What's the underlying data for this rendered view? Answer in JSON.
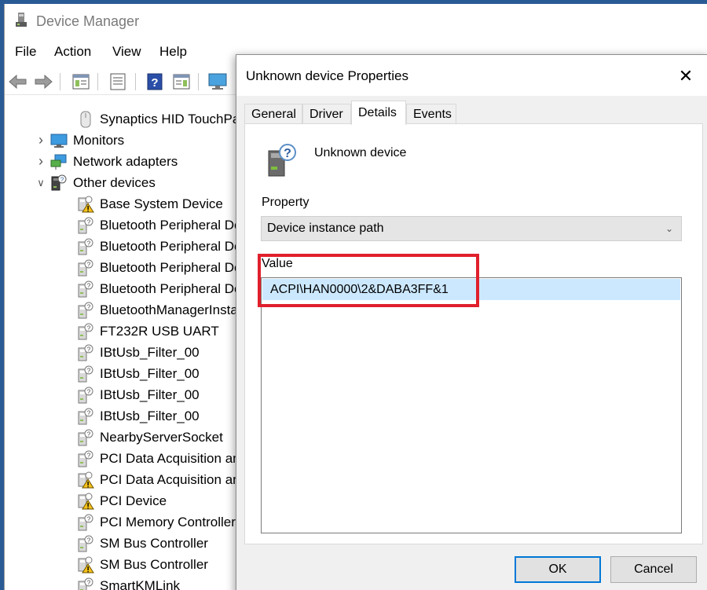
{
  "device_manager": {
    "title": "Device Manager",
    "menu": [
      "File",
      "Action",
      "View",
      "Help"
    ],
    "toolbar_icons": [
      "back-arrow-icon",
      "forward-arrow-icon",
      "properties-icon",
      "list-icon",
      "help-icon",
      "scan-icon",
      "monitor-icon"
    ],
    "tree": [
      {
        "label": "Synaptics HID TouchPad",
        "level": 2,
        "icon": "touchpad-icon"
      },
      {
        "label": "Monitors",
        "level": 1,
        "expander": "collapsed",
        "icon": "monitor-icon"
      },
      {
        "label": "Network adapters",
        "level": 1,
        "expander": "collapsed",
        "icon": "network-adapter-icon"
      },
      {
        "label": "Other devices",
        "level": 1,
        "expander": "expanded",
        "icon": "unknown-device-icon"
      },
      {
        "label": "Base System Device",
        "level": 2,
        "icon": "device-warning-icon"
      },
      {
        "label": "Bluetooth Peripheral Device",
        "level": 2,
        "icon": "unknown-device-icon"
      },
      {
        "label": "Bluetooth Peripheral Device",
        "level": 2,
        "icon": "unknown-device-icon"
      },
      {
        "label": "Bluetooth Peripheral Device",
        "level": 2,
        "icon": "unknown-device-icon"
      },
      {
        "label": "Bluetooth Peripheral Device",
        "level": 2,
        "icon": "unknown-device-icon"
      },
      {
        "label": "BluetoothManagerInstaller",
        "level": 2,
        "icon": "unknown-device-icon"
      },
      {
        "label": "FT232R USB UART",
        "level": 2,
        "icon": "unknown-device-icon"
      },
      {
        "label": "IBtUsb_Filter_00",
        "level": 2,
        "icon": "unknown-device-icon"
      },
      {
        "label": "IBtUsb_Filter_00",
        "level": 2,
        "icon": "unknown-device-icon"
      },
      {
        "label": "IBtUsb_Filter_00",
        "level": 2,
        "icon": "unknown-device-icon"
      },
      {
        "label": "IBtUsb_Filter_00",
        "level": 2,
        "icon": "unknown-device-icon"
      },
      {
        "label": "NearbyServerSocket",
        "level": 2,
        "icon": "unknown-device-icon"
      },
      {
        "label": "PCI Data Acquisition and Signal Processing Controller",
        "level": 2,
        "icon": "unknown-device-icon"
      },
      {
        "label": "PCI Data Acquisition and Signal Processing Controller",
        "level": 2,
        "icon": "device-warning-icon"
      },
      {
        "label": "PCI Device",
        "level": 2,
        "icon": "device-warning-icon"
      },
      {
        "label": "PCI Memory Controller",
        "level": 2,
        "icon": "unknown-device-icon"
      },
      {
        "label": "SM Bus Controller",
        "level": 2,
        "icon": "unknown-device-icon"
      },
      {
        "label": "SM Bus Controller",
        "level": 2,
        "icon": "device-warning-icon"
      },
      {
        "label": "SmartKMLink",
        "level": 2,
        "icon": "unknown-device-icon"
      }
    ]
  },
  "dialog": {
    "title": "Unknown device Properties",
    "close_glyph": "✕",
    "tabs": [
      {
        "label": "General",
        "active": false
      },
      {
        "label": "Driver",
        "active": false
      },
      {
        "label": "Details",
        "active": true
      },
      {
        "label": "Events",
        "active": false
      }
    ],
    "device_name": "Unknown device",
    "property_label": "Property",
    "property_selected": "Device instance path",
    "value_label": "Value",
    "value_items": [
      "ACPI\\HAN0000\\2&DABA3FF&1"
    ],
    "ok_label": "OK",
    "cancel_label": "Cancel",
    "highlight_color": "#e0202c"
  }
}
